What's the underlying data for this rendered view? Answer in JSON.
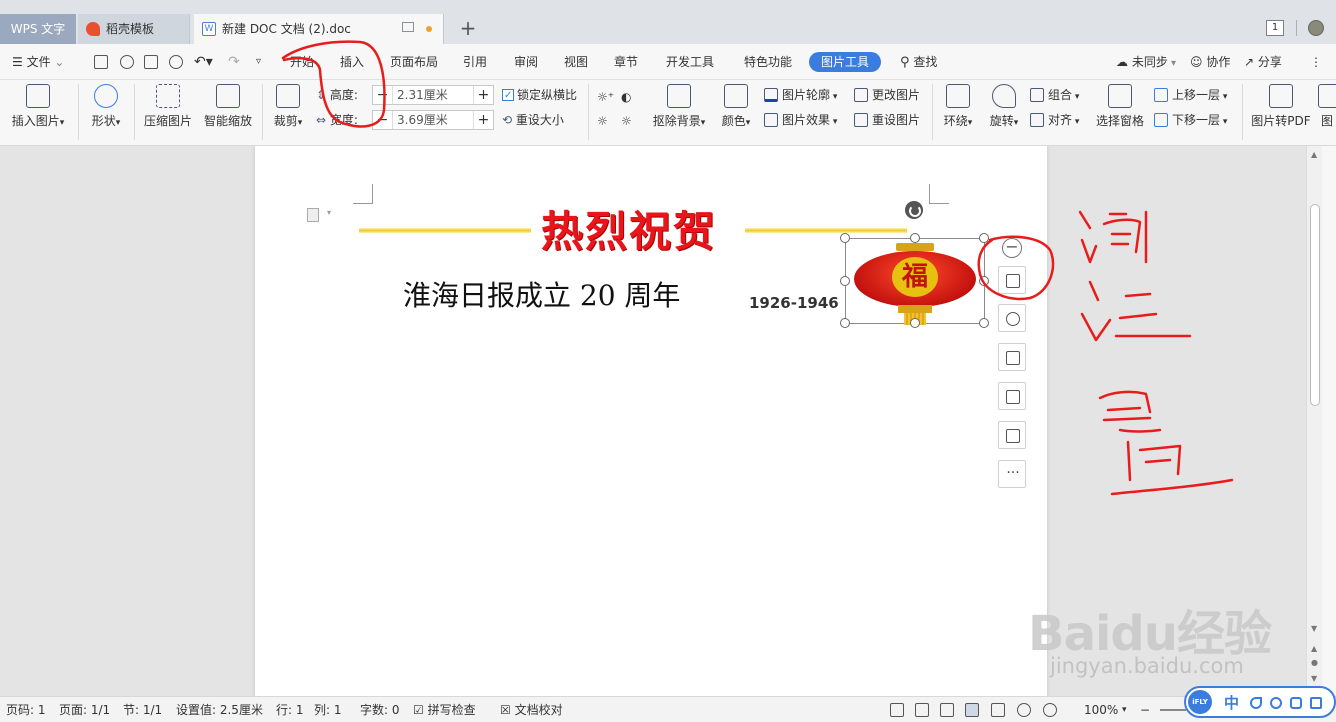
{
  "title_bar": {
    "app_tab": "WPS 文字",
    "template_tab": "稻壳模板",
    "doc_tab": "新建 DOC 文档 (2).doc",
    "new_tab_label": "+",
    "window_count": "1"
  },
  "menu": {
    "file": "文件",
    "items": [
      "开始",
      "插入",
      "页面布局",
      "引用",
      "审阅",
      "视图",
      "章节",
      "开发工具",
      "特色功能"
    ],
    "active": "图片工具",
    "search": "查找",
    "sync": "未同步",
    "collab": "协作",
    "share": "分享",
    "more": "⋮"
  },
  "ribbon": {
    "insert_picture": "插入图片",
    "shape": "形状",
    "compress": "压缩图片",
    "smart_zoom": "智能缩放",
    "crop": "裁剪",
    "height_label": "高度:",
    "height_value": "2.31厘米",
    "width_label": "宽度:",
    "width_value": "3.69厘米",
    "lock_ratio": "锁定纵横比",
    "reset_size": "重设大小",
    "remove_bg": "抠除背景",
    "color": "颜色",
    "outline": "图片轮廓",
    "effects": "图片效果",
    "change_pic": "更改图片",
    "reset_pic": "重设图片",
    "wrap": "环绕",
    "rotate": "旋转",
    "group": "组合",
    "align": "对齐",
    "select_pane": "选择窗格",
    "bring_forward": "上移一层",
    "send_backward": "下移一层",
    "to_pdf": "图片转PDF",
    "cut_off": "图"
  },
  "document": {
    "headline": "热烈祝贺",
    "subtitle": "淮海日报成立 20 周年",
    "years": "1926-1946",
    "lantern_char": "福"
  },
  "floatbar": {
    "more": "···"
  },
  "status_bar": {
    "page": "页码: 1",
    "pages": "页面: 1/1",
    "section": "节: 1/1",
    "setting": "设置值: 2.5厘米",
    "row": "行: 1",
    "col": "列: 1",
    "words": "字数: 0",
    "spell": "拼写检查",
    "proof": "文档校对",
    "zoom": "100%",
    "ifly_label": "iFLY",
    "ime": "中"
  },
  "watermark": {
    "logo": "Baidu经验",
    "url": "jingyan.baidu.com"
  },
  "colors": {
    "accent": "#3b7ddd",
    "annotation": "#e81c1c",
    "headline": "#e8151b"
  }
}
